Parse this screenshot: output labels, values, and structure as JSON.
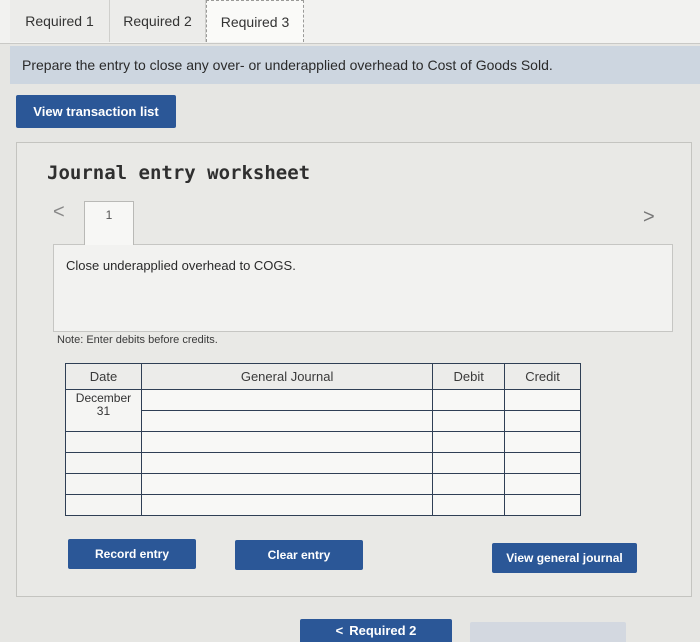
{
  "tabs": [
    {
      "label": "Required 1"
    },
    {
      "label": "Required 2"
    },
    {
      "label": "Required 3"
    }
  ],
  "instruction": "Prepare the entry to close any over- or underapplied overhead to Cost of Goods Sold.",
  "view_transactions_label": "View transaction list",
  "worksheet": {
    "title": "Journal entry worksheet",
    "entry_number": "1",
    "prev_glyph": "<",
    "next_glyph": ">",
    "description": "Close underapplied overhead to COGS.",
    "note": "Note: Enter debits before credits.",
    "columns": {
      "date": "Date",
      "account": "General Journal",
      "debit": "Debit",
      "credit": "Credit"
    },
    "rows": [
      {
        "date_month": "December",
        "date_day": "31"
      }
    ]
  },
  "buttons": {
    "record": "Record entry",
    "clear": "Clear entry",
    "view_general": "View general journal"
  },
  "footer": {
    "prev_glyph": "<",
    "prev_label": "Required 2"
  }
}
